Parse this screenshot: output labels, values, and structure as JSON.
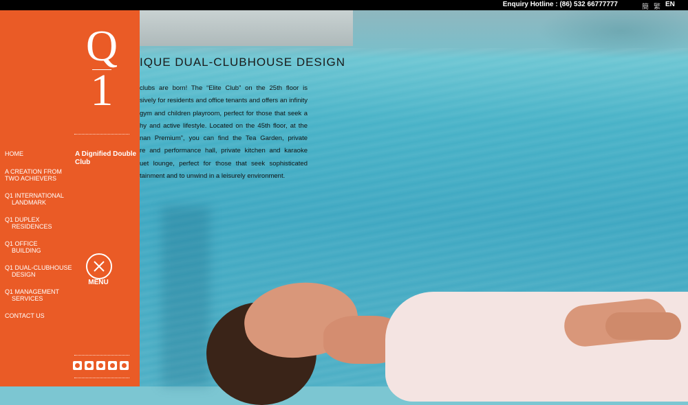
{
  "topbar": {
    "hotline": "Enquiry Hotline : (86) 532 66777777",
    "lang_sc": "簡",
    "lang_tc": "繁",
    "lang_en": "EN"
  },
  "sidebar": {
    "nav": [
      "HOME",
      "A CREATION FROM TWO ACHIEVERS",
      "Q1 INTERNATIONAL LANDMARK",
      "Q1 DUPLEX RESIDENCES",
      "Q1 OFFICE BUILDING",
      "Q1 DUAL-CLUBHOUSE DESIGN",
      "Q1 MANAGEMENT SERVICES",
      "CONTACT US"
    ],
    "nav_lines": [
      [
        "HOME"
      ],
      [
        "A CREATION FROM",
        "TWO ACHIEVERS"
      ],
      [
        "Q1 INTERNATIONAL",
        "LANDMARK"
      ],
      [
        "Q1 DUPLEX",
        "RESIDENCES"
      ],
      [
        "Q1 OFFICE",
        "BUILDING"
      ],
      [
        "Q1 DUAL-CLUBHOUSE",
        "DESIGN"
      ],
      [
        "Q1 MANAGEMENT",
        "SERVICES"
      ],
      [
        "CONTACT US"
      ]
    ],
    "submenu_title": "A Dignified Double Club",
    "menu_label": "MENU",
    "logo_q": "Q",
    "logo_one": "1",
    "social_icons": [
      "weibo-icon",
      "wechat-moments-icon",
      "renren-icon",
      "douban-icon",
      "wechat-icon"
    ]
  },
  "main": {
    "heading": "IQUE DUAL-CLUBHOUSE DESIGN",
    "paragraph_lines": [
      "clubs are born! The “Elite Club” on the 25th floor is",
      "sively for residents and office tenants and offers an infinity",
      "gym and children playroom, perfect for those that seek a",
      "hy and active lifestyle. Located on the 45th floor, at the",
      "nan Premium”, you can find the Tea Garden, private",
      "re and performance hall, private kitchen and karaoke",
      "uet lounge, perfect for those that seek sophisticated",
      "tainment and to unwind in a leisurely environment."
    ]
  },
  "colors": {
    "sidebar": "#ea5b26",
    "topbar": "#000000",
    "pool": "#49b3c8"
  }
}
